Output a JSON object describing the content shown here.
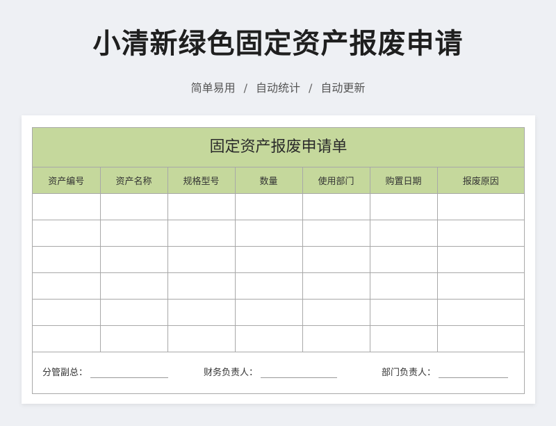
{
  "header": {
    "title": "小清新绿色固定资产报废申请",
    "subtitle_parts": [
      "简单易用",
      "自动统计",
      "自动更新"
    ],
    "separator": "/"
  },
  "form": {
    "title": "固定资产报废申请单",
    "columns": [
      "资产编号",
      "资产名称",
      "规格型号",
      "数量",
      "使用部门",
      "购置日期",
      "报废原因"
    ],
    "empty_rows": 6,
    "signatures": [
      "分管副总：",
      "财务负责人：",
      "部门负责人："
    ]
  },
  "colors": {
    "header_green": "#c5d89c",
    "background": "#eef0f4",
    "border": "#a8a8a8"
  }
}
